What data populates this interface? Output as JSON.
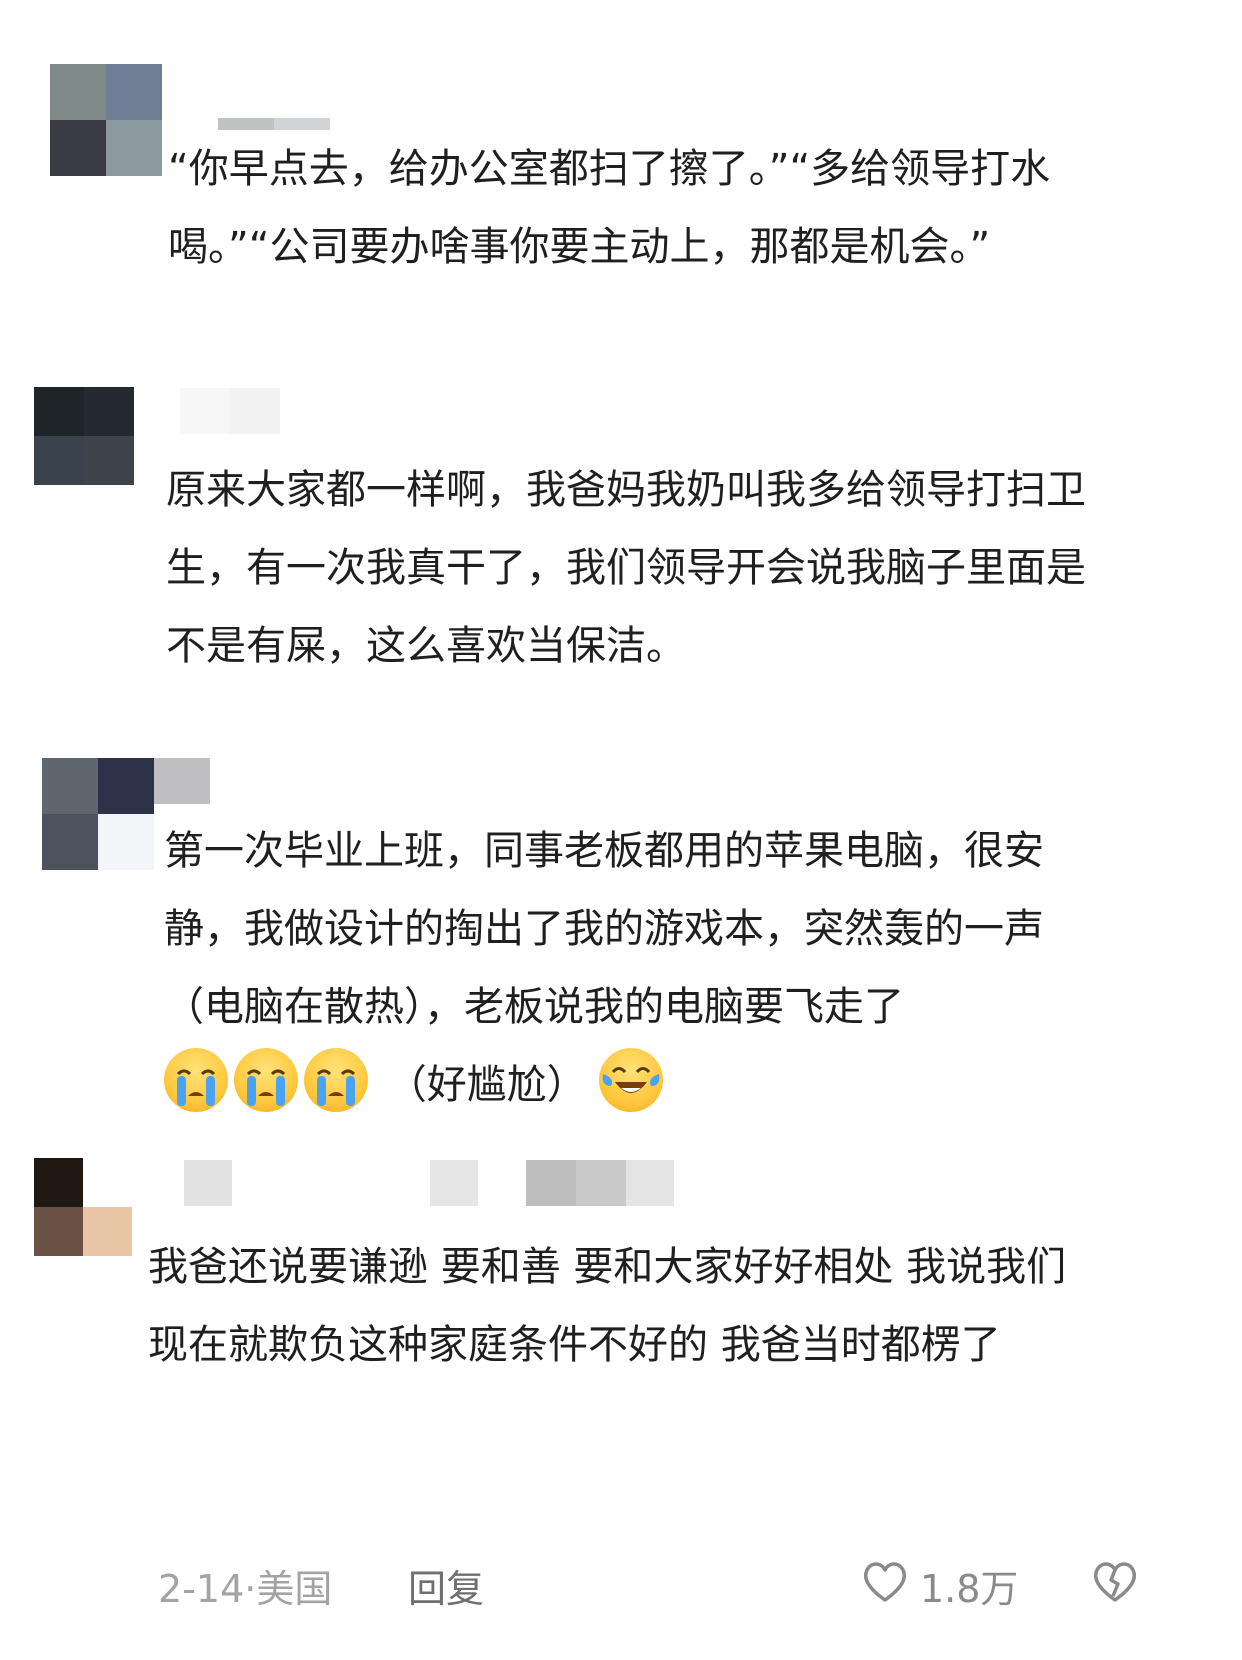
{
  "comments": [
    {
      "text": "“你早点去，给办公室都扫了擦了。”“多给领导打水喝。”“公司要办啥事你要主动上，那都是机会。”"
    },
    {
      "text": "原来大家都一样啊，我爸妈我奶叫我多给领导打扫卫生，有一次我真干了，我们领导开会说我脑子里面是不是有屎，这么喜欢当保洁。"
    },
    {
      "text": "第一次毕业上班，同事老板都用的苹果电脑，很安静，我做设计的掏出了我的游戏本，突然轰的一声（电脑在散热），老板说我的电脑要飞走了",
      "emoji_line_text": "（好尴尬）",
      "emojis": [
        "loudly-crying-face",
        "loudly-crying-face",
        "loudly-crying-face",
        "tears-of-joy-face"
      ]
    },
    {
      "text": "我爸还说要谦逊 要和善 要和大家好好相处 我说我们现在就欺负这种家庭条件不好的 我爸当时都楞了"
    }
  ],
  "footer": {
    "date": "2-14·美国",
    "reply_label": "回复",
    "like_count": "1.8万",
    "like_icon": "heart-outline-icon",
    "dislike_icon": "broken-heart-icon"
  },
  "colors": {
    "text": "#1f1f1f",
    "meta": "#a3a3a3",
    "reply": "#6f6f6f",
    "emoji_yellow": "#ffc83d",
    "tear_blue": "#4aa3f0"
  }
}
